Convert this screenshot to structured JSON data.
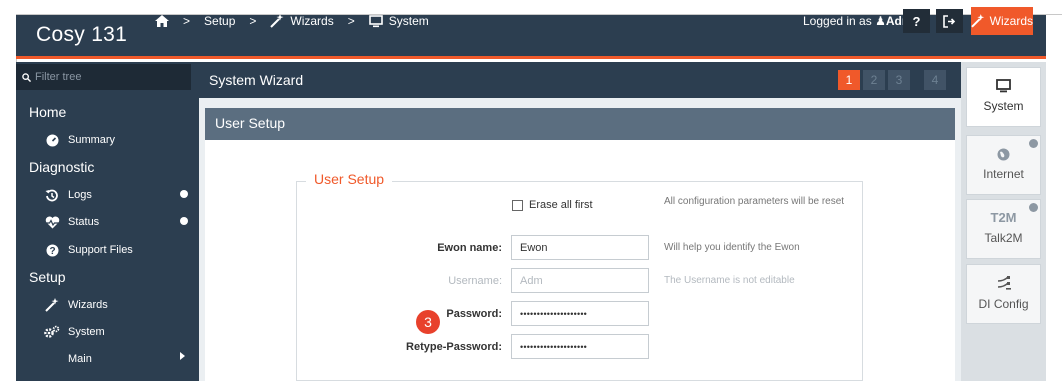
{
  "topbar": {
    "brand": "Cosy",
    "brand_model": "131",
    "breadcrumbs": [
      {
        "label": "",
        "icon": "home-icon"
      },
      {
        "label": "Setup"
      },
      {
        "label": "Wizards",
        "icon": "magic-wand-icon"
      },
      {
        "label": "System",
        "icon": "monitor-icon"
      }
    ],
    "logged_in_prefix": "Logged in as",
    "user": "Adm",
    "wizards_button": "Wizards",
    "accent": "#f0592a",
    "bar_color": "#2c3e50"
  },
  "sidebar": {
    "filter_placeholder": "Filter tree",
    "sections": {
      "home": "Home",
      "diagnostic": "Diagnostic",
      "setup": "Setup"
    },
    "items": {
      "summary": "Summary",
      "logs": "Logs",
      "status": "Status",
      "support_files": "Support Files",
      "wizards": "Wizards",
      "system": "System",
      "main": "Main"
    }
  },
  "main": {
    "title": "System Wizard",
    "steps": [
      "1",
      "2",
      "3",
      "4"
    ],
    "active_step": "1",
    "panel_title": "User Setup",
    "fieldset_legend": "User Setup",
    "erase_label": "Erase all first",
    "erase_checked": false,
    "erase_hint": "All configuration parameters will be reset",
    "ewon_name_label": "Ewon name:",
    "ewon_name_value": "Ewon",
    "ewon_name_hint": "Will help you identify the Ewon",
    "username_label": "Username:",
    "username_value": "Adm",
    "username_hint": "The Username is not editable",
    "password_label": "Password:",
    "password_value": "••••••••••••••••••••",
    "retype_label": "Retype-Password:",
    "retype_value": "••••••••••••••••••••",
    "annotation_badge": "3"
  },
  "right_tabs": {
    "system": "System",
    "internet": "Internet",
    "talk2m": "Talk2M",
    "talk2m_logo": "T2M",
    "di_config": "DI Config"
  }
}
